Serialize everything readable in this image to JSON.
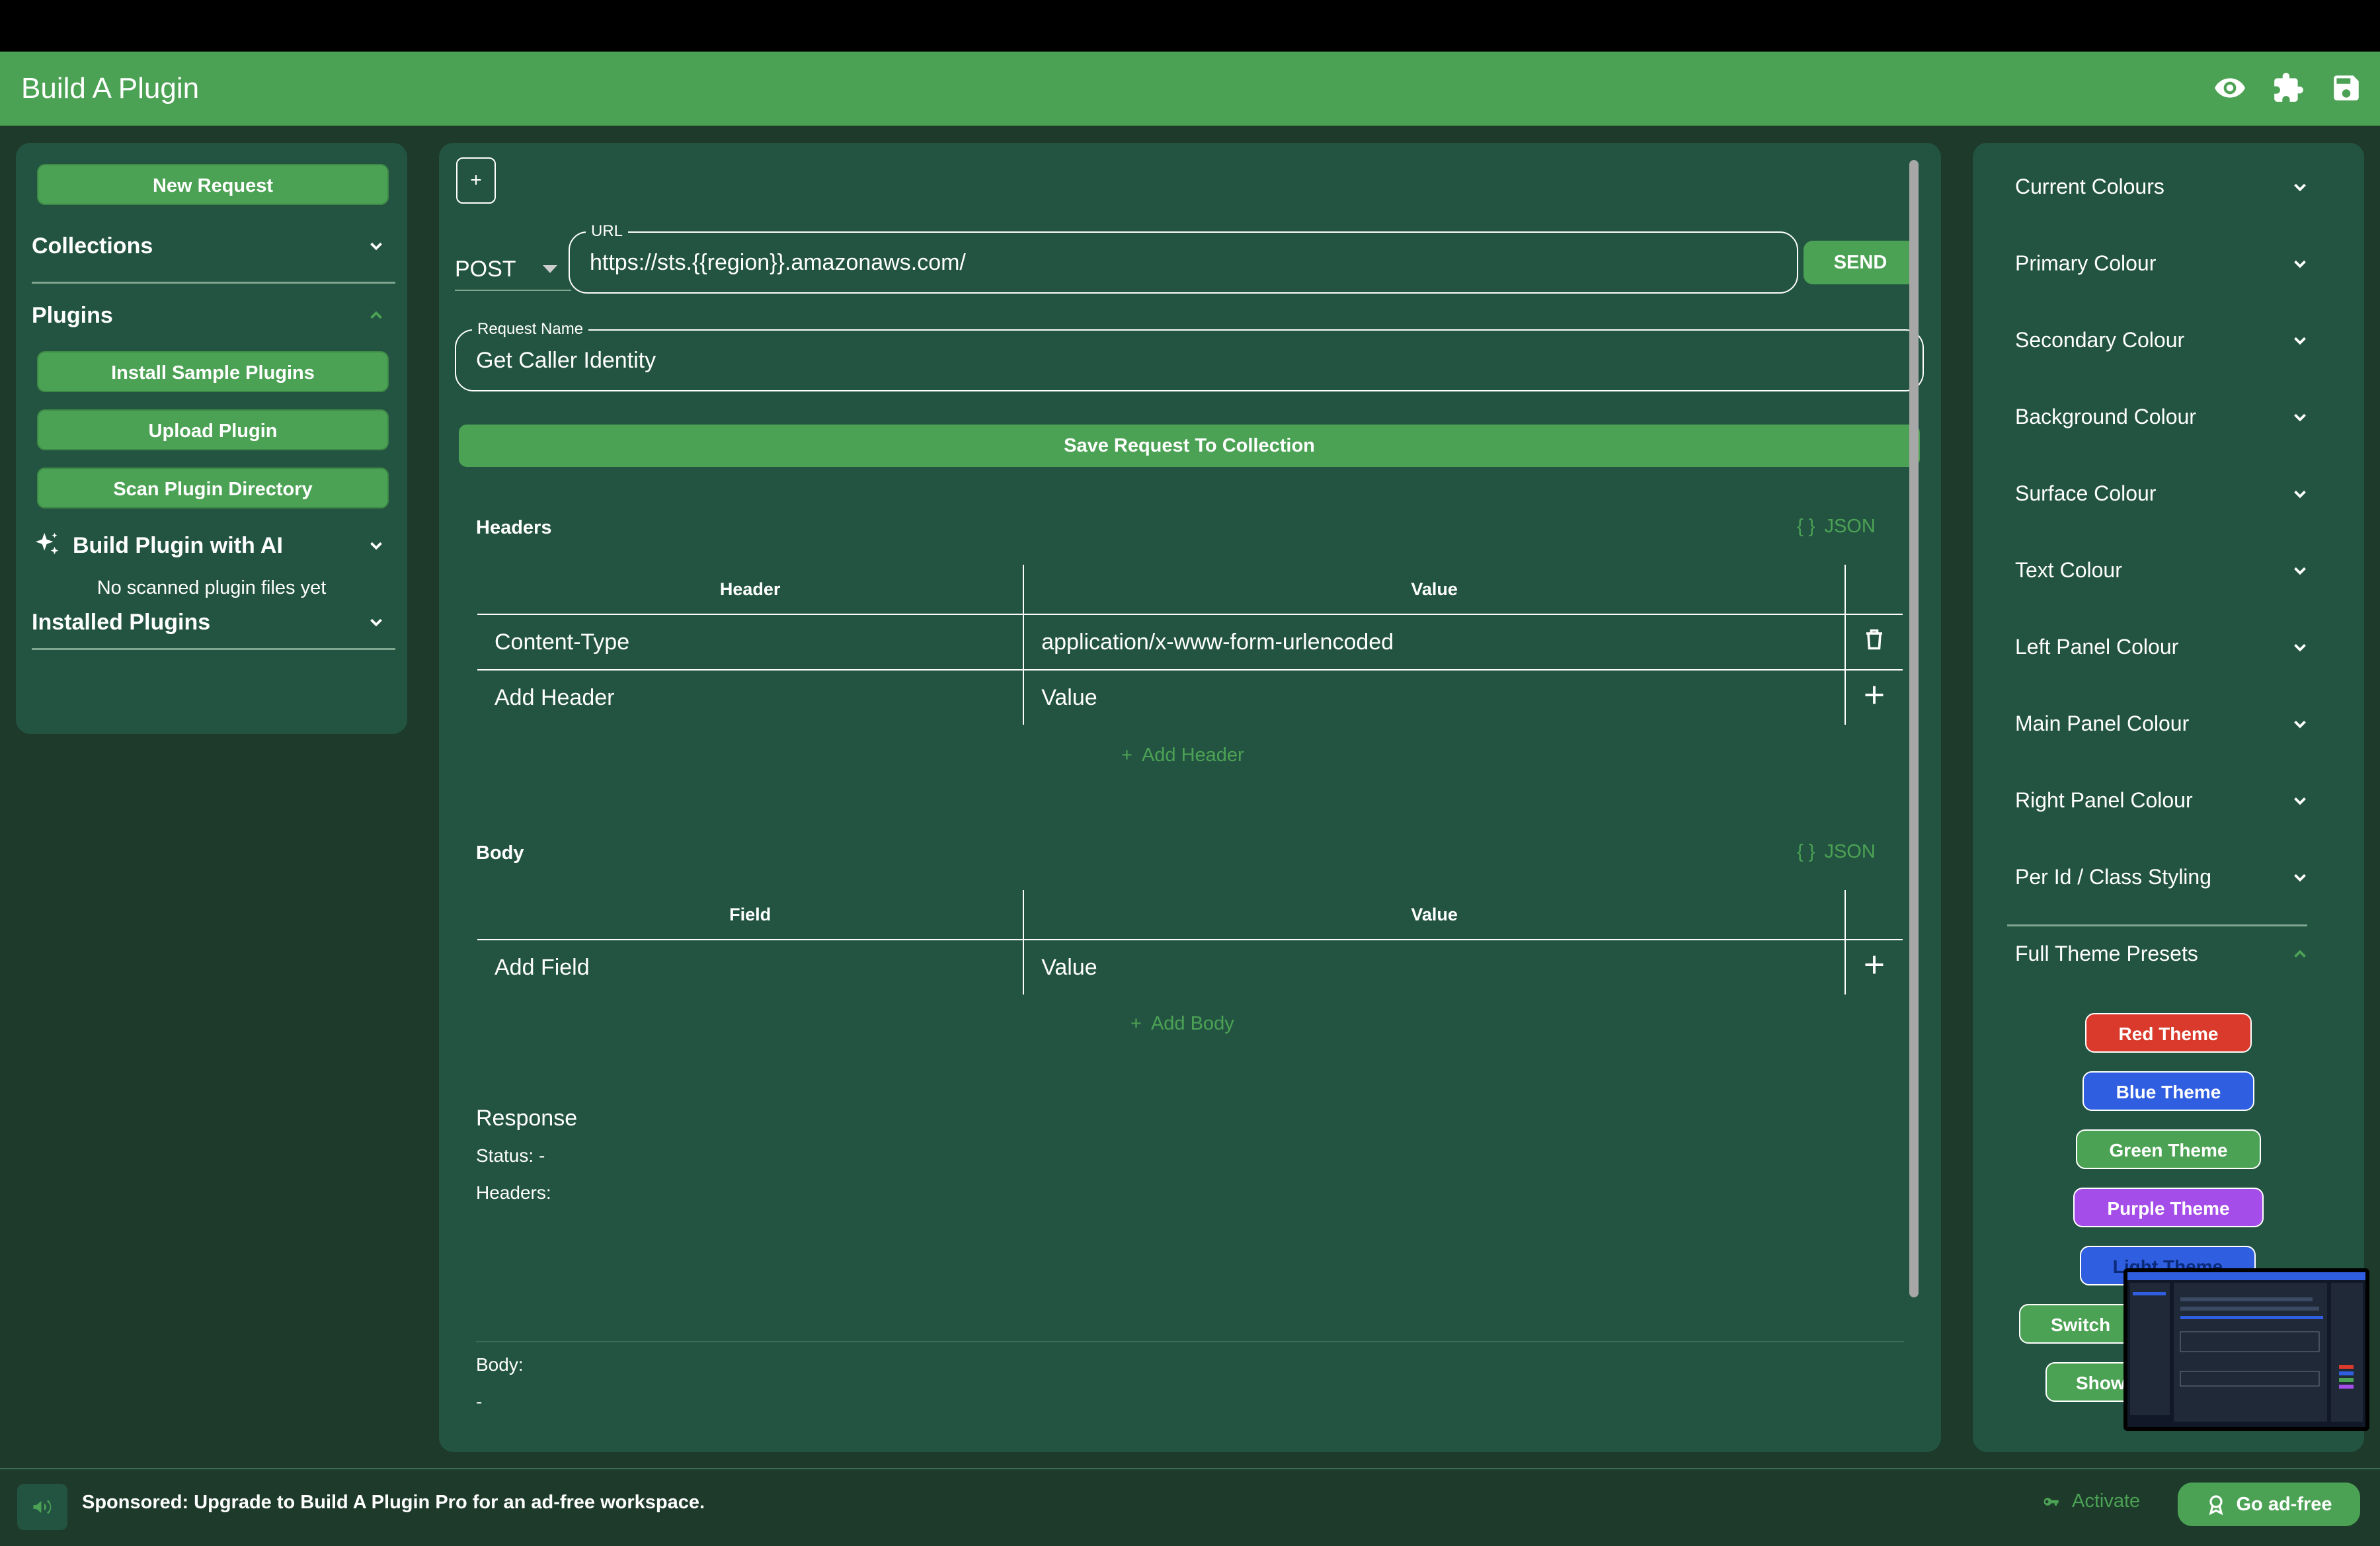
{
  "app": {
    "title": "Build A Plugin"
  },
  "appbar_icons": [
    "eye-icon",
    "puzzle-icon",
    "save-icon"
  ],
  "left_panel": {
    "new_request": "New Request",
    "collections": "Collections",
    "plugins": "Plugins",
    "plugin_buttons": [
      "Install Sample Plugins",
      "Upload Plugin",
      "Scan Plugin Directory"
    ],
    "build_ai": "Build Plugin with AI",
    "no_scanned": "No scanned plugin files yet",
    "installed": "Installed Plugins"
  },
  "request": {
    "plus": "+",
    "method": "POST",
    "url_label": "URL",
    "url": "https://sts.{{region}}.amazonaws.com/",
    "send": "SEND",
    "name_label": "Request Name",
    "name": "Get Caller Identity",
    "save_to_collection": "Save Request To Collection"
  },
  "headers": {
    "title": "Headers",
    "json": "JSON",
    "col_header": "Header",
    "col_value": "Value",
    "rows": [
      {
        "key": "Content-Type",
        "value": "application/x-www-form-urlencoded"
      }
    ],
    "new_key_placeholder": "Add Header",
    "new_value_placeholder": "Value",
    "add_link": "Add Header"
  },
  "body": {
    "title": "Body",
    "json": "JSON",
    "col_field": "Field",
    "col_value": "Value",
    "new_key_placeholder": "Add Field",
    "new_value_placeholder": "Value",
    "add_link": "Add Body"
  },
  "response": {
    "title": "Response",
    "status": "Status: -",
    "headers": "Headers:",
    "body": "Body:",
    "body_value": "-"
  },
  "right_panel": {
    "items": [
      "Current Colours",
      "Primary Colour",
      "Secondary Colour",
      "Background Colour",
      "Surface Colour",
      "Text Colour",
      "Left Panel Colour",
      "Main Panel Colour",
      "Right Panel Colour",
      "Per Id / Class Styling",
      "Full Theme Presets"
    ],
    "themes": [
      {
        "label": "Red Theme",
        "color": "#d93a2b"
      },
      {
        "label": "Blue Theme",
        "color": "#2f5fe0"
      },
      {
        "label": "Green Theme",
        "color": "#4ca254"
      },
      {
        "label": "Purple Theme",
        "color": "#a44de8"
      },
      {
        "label": "Light Theme",
        "color": "#2f5fe0"
      }
    ],
    "partial_buttons": [
      "Switch",
      "Show"
    ]
  },
  "ad": {
    "text": "Sponsored: Upgrade to Build A Plugin Pro for an ad-free workspace.",
    "activate": "Activate",
    "go_adfree": "Go ad-free"
  },
  "colors": {
    "accent": "#4ca254",
    "panel": "#235442",
    "background": "#1d3a2b"
  }
}
